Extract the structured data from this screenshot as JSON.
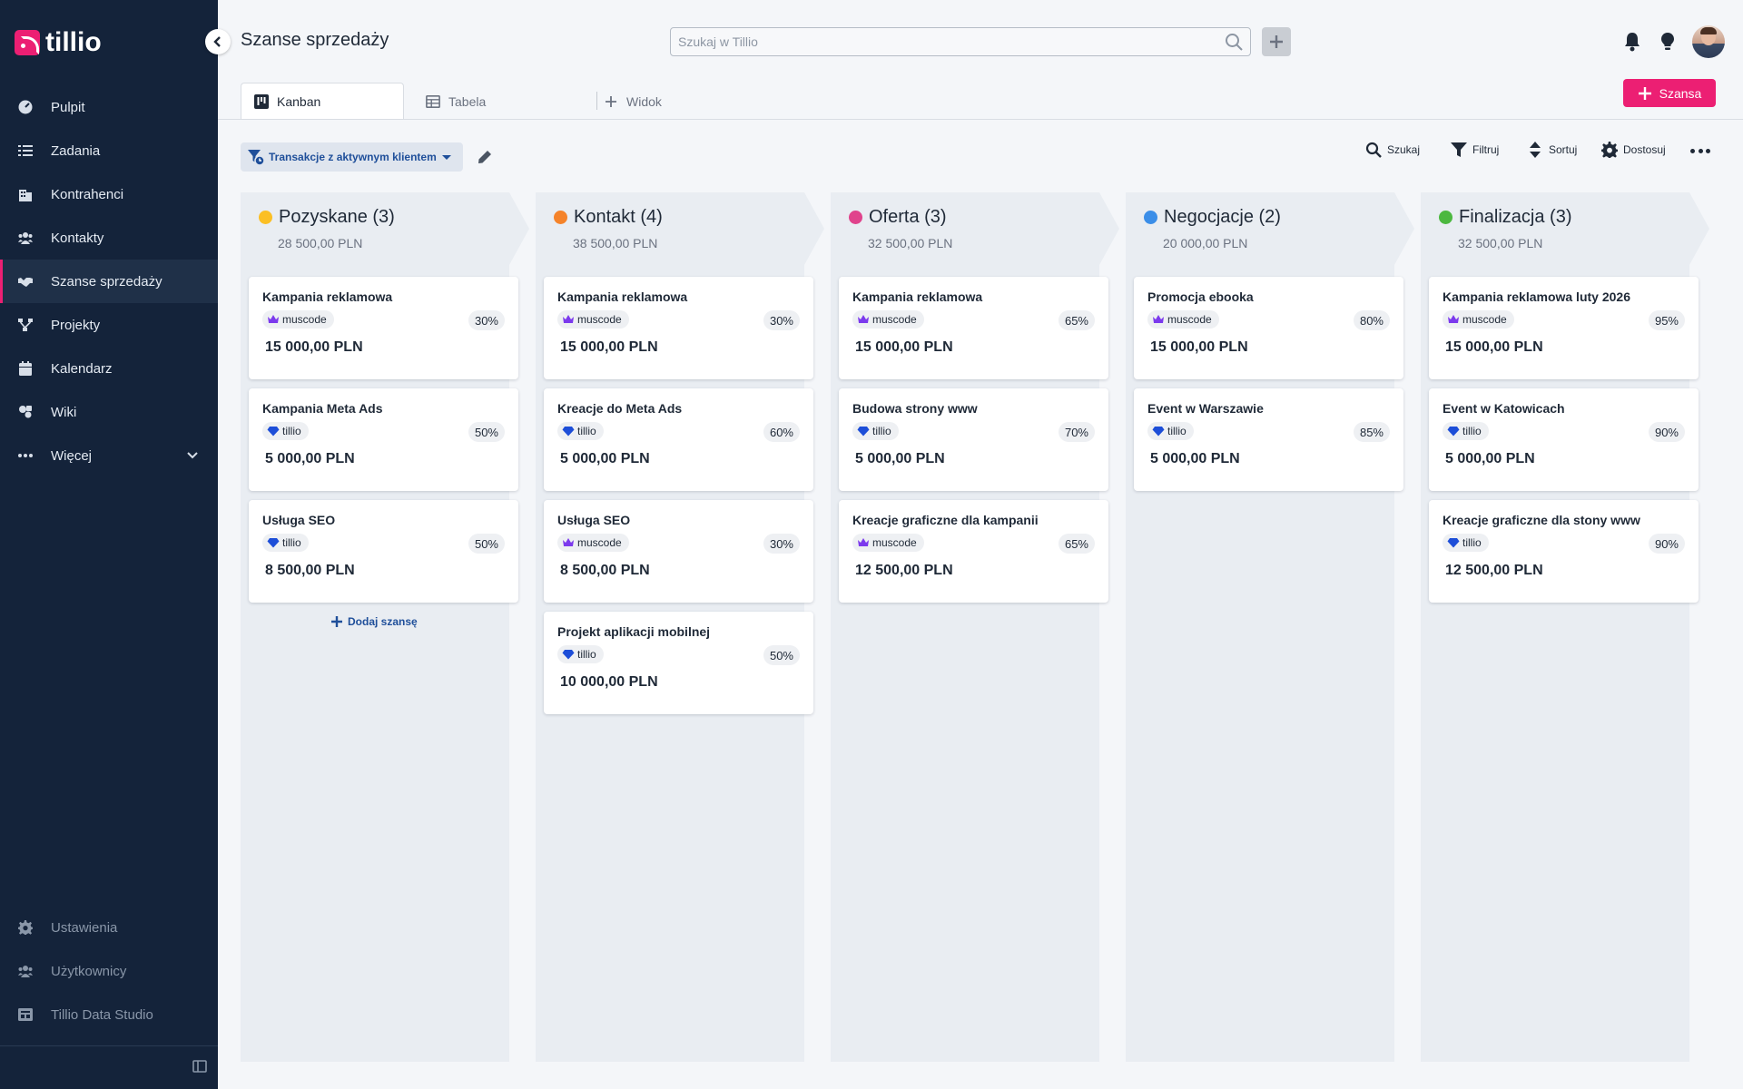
{
  "app": {
    "name": "tillio",
    "page_title": "Szanse sprzedaży",
    "brand_color": "#ec1f73"
  },
  "sidebar": {
    "items": [
      {
        "label": "Pulpit",
        "icon": "dashboard-icon"
      },
      {
        "label": "Zadania",
        "icon": "tasks-icon"
      },
      {
        "label": "Kontrahenci",
        "icon": "building-icon"
      },
      {
        "label": "Kontakty",
        "icon": "users-icon"
      },
      {
        "label": "Szanse sprzedaży",
        "icon": "handshake-icon",
        "active": true
      },
      {
        "label": "Projekty",
        "icon": "projects-icon"
      },
      {
        "label": "Kalendarz",
        "icon": "calendar-icon"
      },
      {
        "label": "Wiki",
        "icon": "wiki-icon"
      },
      {
        "label": "Więcej",
        "icon": "more-icon"
      }
    ],
    "bottom_items": [
      {
        "label": "Ustawienia",
        "icon": "gear-icon"
      },
      {
        "label": "Użytkownicy",
        "icon": "users-icon"
      },
      {
        "label": "Tillio Data Studio",
        "icon": "data-studio-icon"
      }
    ]
  },
  "header": {
    "search_placeholder": "Szukaj w Tillio"
  },
  "tabs": [
    {
      "label": "Kanban",
      "icon": "kanban-icon",
      "active": true
    },
    {
      "label": "Tabela",
      "icon": "table-icon"
    },
    {
      "label": "Widok",
      "icon": "plus-icon"
    }
  ],
  "new_button": "Szansa",
  "toolbar": {
    "filter": "Transakcje z aktywnym klientem",
    "search": "Szukaj",
    "filter_btn": "Filtruj",
    "sort": "Sortuj",
    "customize": "Dostosuj"
  },
  "add_deal": "Dodaj szansę",
  "columns": [
    {
      "title": "Pozyskane (3)",
      "sum": "28 500,00 PLN",
      "color": "#fbbf24",
      "cards": [
        {
          "title": "Kampania reklamowa",
          "client": "muscode",
          "client_type": "crown",
          "prob": "30%",
          "amount": "15 000,00 PLN"
        },
        {
          "title": "Kampania Meta Ads",
          "client": "tillio",
          "client_type": "gem",
          "prob": "50%",
          "amount": "5 000,00 PLN"
        },
        {
          "title": "Usługa SEO",
          "client": "tillio",
          "client_type": "gem",
          "prob": "50%",
          "amount": "8 500,00 PLN"
        }
      ]
    },
    {
      "title": "Kontakt (4)",
      "sum": "38 500,00 PLN",
      "color": "#f5832a",
      "cards": [
        {
          "title": "Kampania reklamowa",
          "client": "muscode",
          "client_type": "crown",
          "prob": "30%",
          "amount": "15 000,00 PLN"
        },
        {
          "title": "Kreacje do Meta Ads",
          "client": "tillio",
          "client_type": "gem",
          "prob": "60%",
          "amount": "5 000,00 PLN"
        },
        {
          "title": "Usługa SEO",
          "client": "muscode",
          "client_type": "crown",
          "prob": "30%",
          "amount": "8 500,00 PLN"
        },
        {
          "title": "Projekt aplikacji mobilnej",
          "client": "tillio",
          "client_type": "gem",
          "prob": "50%",
          "amount": "10 000,00 PLN"
        }
      ]
    },
    {
      "title": "Oferta (3)",
      "sum": "32 500,00 PLN",
      "color": "#e0438c",
      "cards": [
        {
          "title": "Kampania reklamowa",
          "client": "muscode",
          "client_type": "crown",
          "prob": "65%",
          "amount": "15 000,00 PLN"
        },
        {
          "title": "Budowa strony www",
          "client": "tillio",
          "client_type": "gem",
          "prob": "70%",
          "amount": "5 000,00 PLN"
        },
        {
          "title": "Kreacje graficzne dla kampanii",
          "client": "muscode",
          "client_type": "crown",
          "prob": "65%",
          "amount": "12 500,00 PLN"
        }
      ]
    },
    {
      "title": "Negocjacje (2)",
      "sum": "20 000,00 PLN",
      "color": "#3b8ee8",
      "cards": [
        {
          "title": "Promocja ebooka",
          "client": "muscode",
          "client_type": "crown",
          "prob": "80%",
          "amount": "15 000,00 PLN"
        },
        {
          "title": "Event w Warszawie",
          "client": "tillio",
          "client_type": "gem",
          "prob": "85%",
          "amount": "5 000,00 PLN"
        }
      ]
    },
    {
      "title": "Finalizacja (3)",
      "sum": "32 500,00 PLN",
      "color": "#4cb83f",
      "cards": [
        {
          "title": "Kampania reklamowa luty 2026",
          "client": "muscode",
          "client_type": "crown",
          "prob": "95%",
          "amount": "15 000,00 PLN"
        },
        {
          "title": "Event w Katowicach",
          "client": "tillio",
          "client_type": "gem",
          "prob": "90%",
          "amount": "5 000,00 PLN"
        },
        {
          "title": "Kreacje graficzne dla stony www",
          "client": "tillio",
          "client_type": "gem",
          "prob": "90%",
          "amount": "12 500,00 PLN"
        }
      ]
    }
  ]
}
